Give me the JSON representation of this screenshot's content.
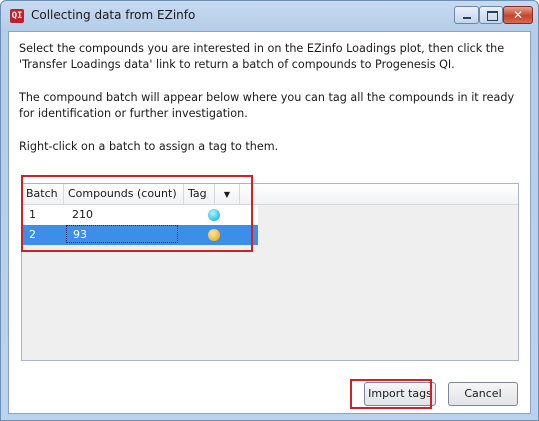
{
  "window": {
    "app_icon": "QI",
    "title": "Collecting data from EZinfo",
    "controls": {
      "minimize_icon": "minimize-icon",
      "maximize_icon": "maximize-icon",
      "close_icon": "close-icon",
      "close_glyph": "✕"
    }
  },
  "instructions": {
    "p1": "Select the compounds you are interested in on the EZinfo Loadings plot, then click the 'Transfer Loadings data' link to return a batch of compounds to Progenesis QI.",
    "p2": "The compound batch will appear below where you can tag all the compounds in it ready for identification or further investigation.",
    "p3": "Right-click on a batch to assign a tag to them."
  },
  "grid": {
    "columns": [
      "Batch",
      "Compounds (count)",
      "Tag"
    ],
    "filter_icon": "▼",
    "rows": [
      {
        "batch": "1",
        "count": "210",
        "tag_color": "#29c3ea",
        "selected": false
      },
      {
        "batch": "2",
        "count": "93",
        "tag_color": "#f5b52b",
        "selected": true
      }
    ]
  },
  "buttons": {
    "import": "Import tags",
    "cancel": "Cancel"
  },
  "colors": {
    "highlight_outline": "#d0202a",
    "selection": "#3d8ee8",
    "titlebar": "#b5cde9"
  }
}
